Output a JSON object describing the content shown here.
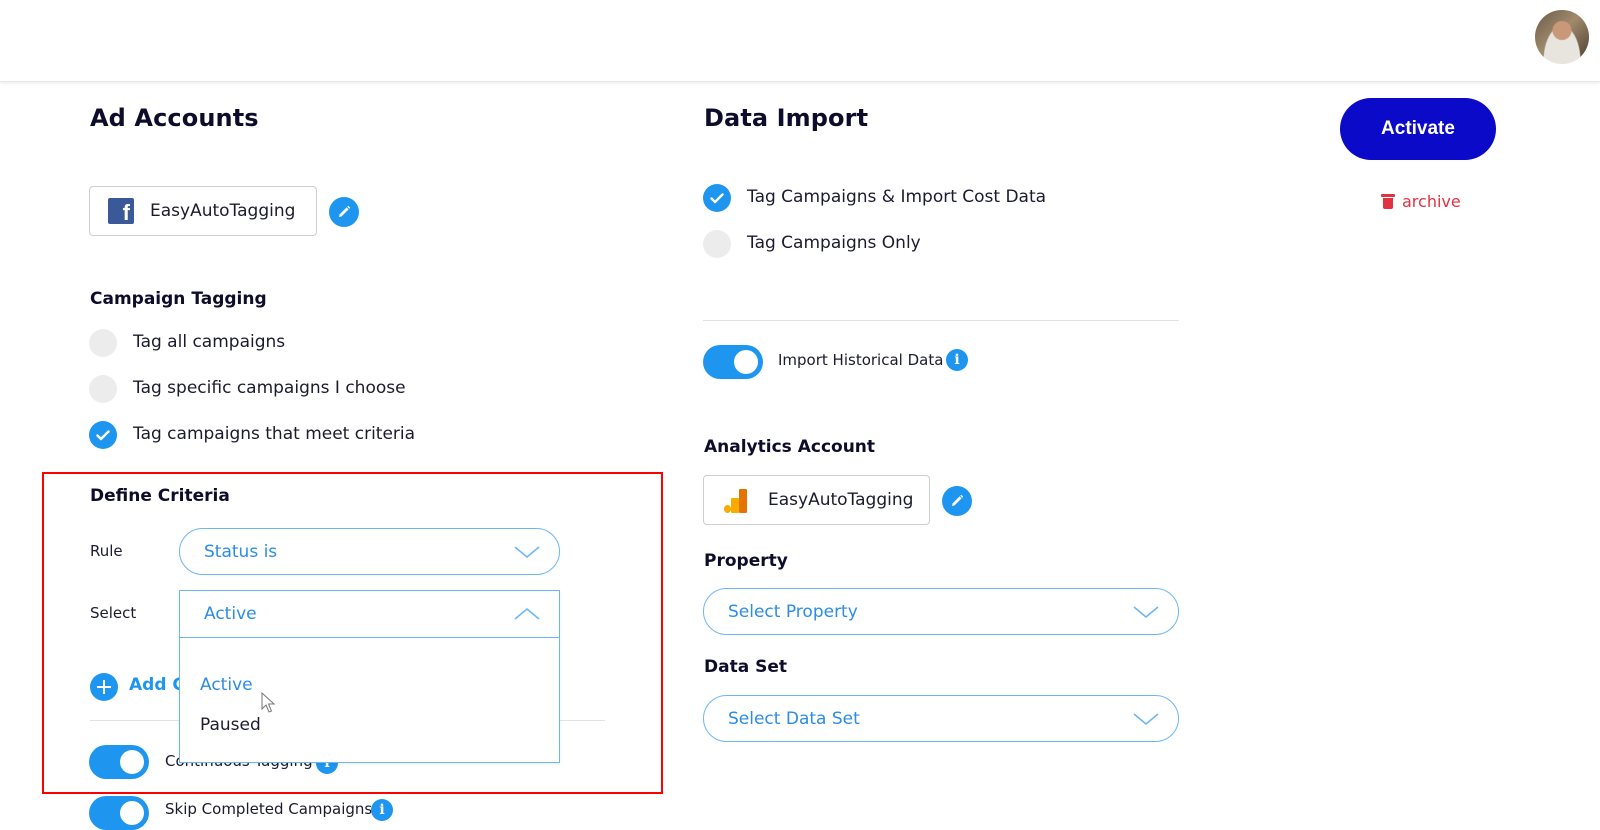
{
  "header": {
    "avatar_alt": "user-avatar"
  },
  "ad_accounts": {
    "title": "Ad Accounts",
    "account": {
      "name": "EasyAutoTagging",
      "platform_icon": "facebook-icon"
    }
  },
  "campaign_tagging": {
    "title": "Campaign Tagging",
    "options": [
      {
        "label": "Tag all campaigns",
        "checked": false
      },
      {
        "label": "Tag specific campaigns I choose",
        "checked": false
      },
      {
        "label": "Tag campaigns that meet criteria",
        "checked": true
      }
    ]
  },
  "define_criteria": {
    "title": "Define Criteria",
    "rule_label": "Rule",
    "rule_value": "Status is",
    "select_label": "Select",
    "select_value": "Active",
    "select_open": true,
    "options": [
      {
        "label": "Active",
        "selected": true
      },
      {
        "label": "Paused",
        "selected": false
      }
    ],
    "add_condition_label": "Add C"
  },
  "toggles_left": [
    {
      "label": "Continuous Tagging",
      "on": true
    },
    {
      "label": "Skip Completed Campaigns",
      "on": true
    }
  ],
  "data_import": {
    "title": "Data Import",
    "options": [
      {
        "label": "Tag Campaigns & Import Cost Data",
        "checked": true
      },
      {
        "label": "Tag Campaigns Only",
        "checked": false
      }
    ],
    "historical_toggle": {
      "label": "Import Historical Data",
      "on": true
    }
  },
  "analytics_account": {
    "title": "Analytics Account",
    "account": {
      "name": "EasyAutoTagging",
      "platform_icon": "google-analytics-icon"
    }
  },
  "property": {
    "title": "Property",
    "placeholder": "Select Property"
  },
  "data_set": {
    "title": "Data Set",
    "placeholder": "Select Data Set"
  },
  "actions": {
    "activate_label": "Activate",
    "archive_label": "archive"
  },
  "colors": {
    "accent": "#1e96f0",
    "primary_button": "#0a0ac8",
    "danger": "#e03240",
    "highlight_frame": "#ff0000"
  }
}
